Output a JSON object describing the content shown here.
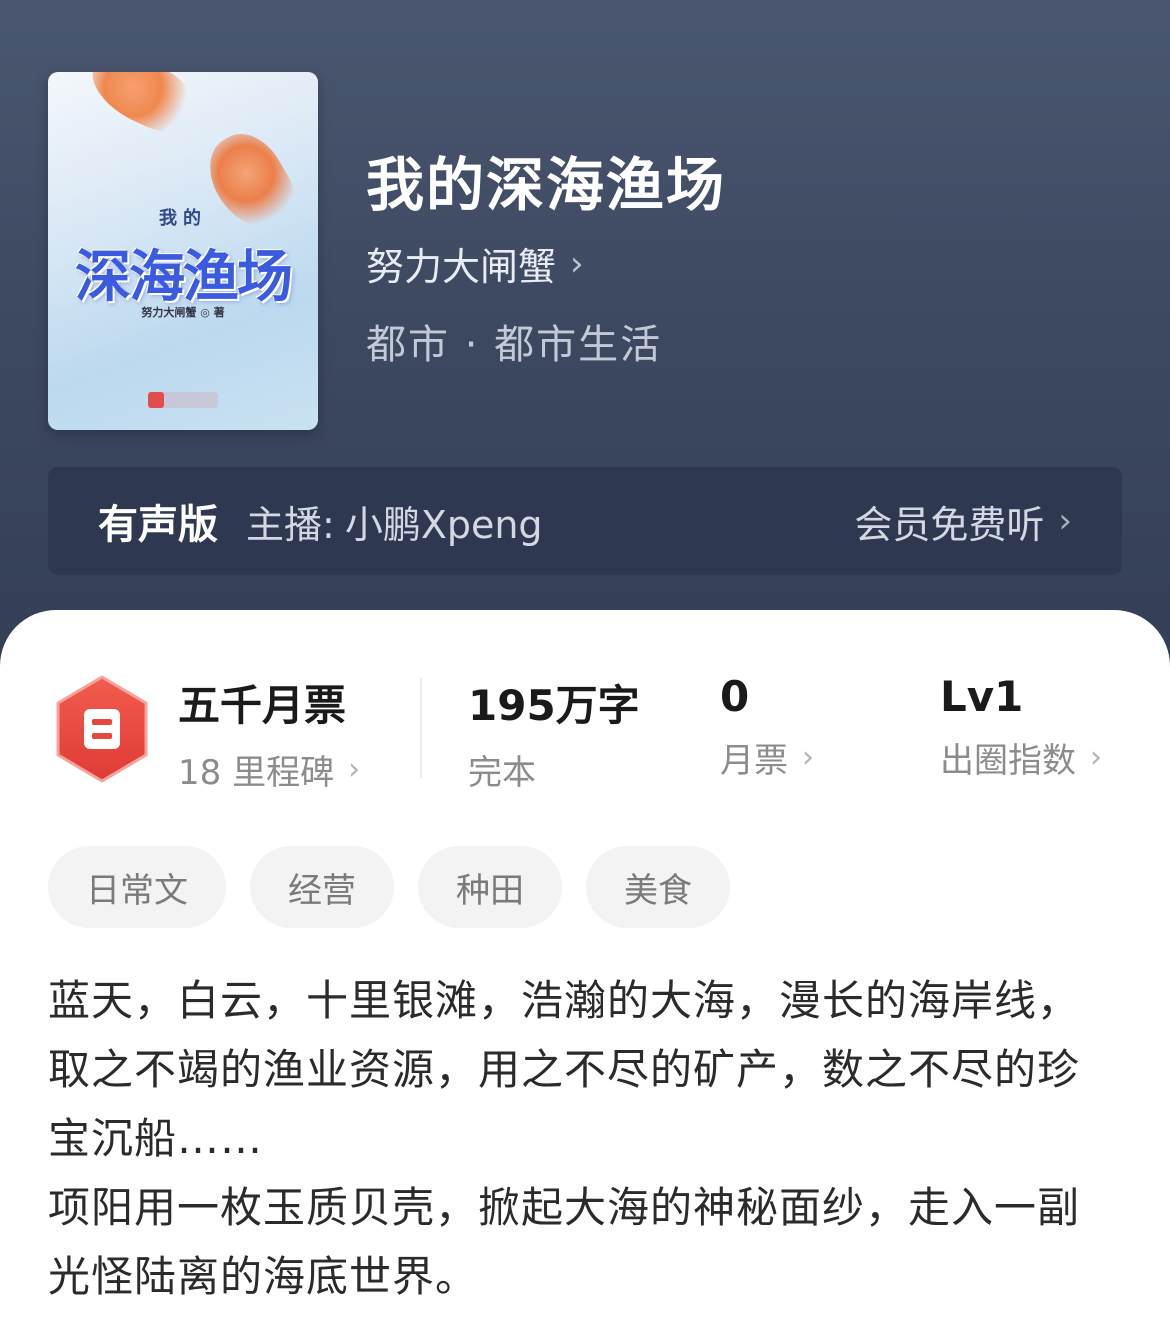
{
  "book": {
    "title": "我的深海渔场",
    "author": "努力大闸蟹",
    "genre": "都市 · 都市生活",
    "cover": {
      "small_title": "我的",
      "big_title": "深海渔场",
      "author_line": "努力大闸蟹 ◎ 著"
    }
  },
  "audio": {
    "edition_label": "有声版",
    "anchor_label": "主播:",
    "anchor_name": "小鹏Xpeng",
    "member_label": "会员免费听"
  },
  "stats": {
    "badge_title": "五千月票",
    "badge_sub": "18 里程碑",
    "word_count": "195万字",
    "status": "完本",
    "monthly_votes": "0",
    "monthly_votes_label": "月票",
    "level": "Lv1",
    "level_label": "出圈指数"
  },
  "tags": [
    "日常文",
    "经营",
    "种田",
    "美食"
  ],
  "synopsis": [
    "蓝天，白云，十里银滩，浩瀚的大海，漫长的海岸线，取之不竭的渔业资源，用之不尽的矿产，数之不尽的珍宝沉船……",
    "项阳用一枚玉质贝壳，掀起大海的神秘面纱，走入一副光怪陆离的海底世界。"
  ],
  "colors": {
    "hero_bg": "#3d4961",
    "badge_red": "#e8473d",
    "cover_title_blue": "#3a5be0"
  },
  "icons": {
    "chevron": "chevron-right-icon",
    "badge": "ticket-badge-icon"
  }
}
